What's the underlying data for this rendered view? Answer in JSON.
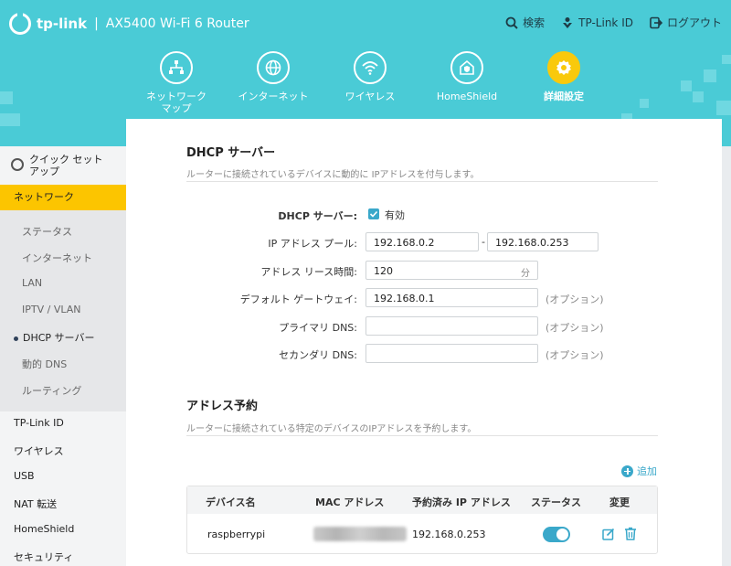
{
  "header": {
    "brand": "tp-link",
    "separator": "|",
    "model": "AX5400 Wi-Fi 6 Router",
    "links": {
      "search": "検索",
      "tplink_id": "TP-Link ID",
      "logout": "ログアウト"
    },
    "nav": [
      {
        "label": "ネットワーク\nマップ",
        "icon": "network-map-icon"
      },
      {
        "label": "インターネット",
        "icon": "globe-icon"
      },
      {
        "label": "ワイヤレス",
        "icon": "wifi-icon"
      },
      {
        "label": "HomeShield",
        "icon": "home-shield-icon"
      },
      {
        "label": "詳細設定",
        "icon": "gear-icon",
        "active": true
      }
    ]
  },
  "sidebar": {
    "quick_setup": "クイック セット\nアップ",
    "network": "ネットワーク",
    "sub_items": [
      "ステータス",
      "インターネット",
      "LAN",
      "IPTV / VLAN",
      "DHCP サーバー",
      "動的 DNS",
      "ルーティング"
    ],
    "active_sub": "DHCP サーバー",
    "main_items": [
      "TP-Link ID",
      "ワイヤレス",
      "USB",
      "NAT 転送",
      "HomeShield",
      "セキュリティ"
    ]
  },
  "dhcp": {
    "title": "DHCP サーバー",
    "desc": "ルーターに接続されているデバイスに動的に IPアドレスを付与します。",
    "server_label": "DHCP サーバー:",
    "server_enabled_label": "有効",
    "pool_label": "IP アドレス プール:",
    "pool_start": "192.168.0.2",
    "pool_dash": "-",
    "pool_end": "192.168.0.253",
    "lease_label": "アドレス リース時間:",
    "lease_value": "120",
    "lease_unit": "分",
    "gateway_label": "デフォルト ゲートウェイ:",
    "gateway_value": "192.168.0.1",
    "primary_dns_label": "プライマリ DNS:",
    "primary_dns_value": "",
    "secondary_dns_label": "セカンダリ DNS:",
    "secondary_dns_value": "",
    "optional": "(オプション)"
  },
  "reservation": {
    "title": "アドレス予約",
    "desc": "ルーターに接続されている特定のデバイスのIPアドレスを予約します。",
    "add_label": "追加",
    "columns": [
      "デバイス名",
      "MAC アドレス",
      "予約済み IP アドレス",
      "ステータス",
      "変更"
    ],
    "rows": [
      {
        "device": "raspberrypi",
        "ip": "192.168.0.253",
        "status_on": true
      }
    ]
  },
  "colors": {
    "header_bg": "#4acbd6",
    "accent": "#3aa8ca",
    "active_nav": "#f9c90c",
    "sidebar_active": "#fcc500"
  }
}
